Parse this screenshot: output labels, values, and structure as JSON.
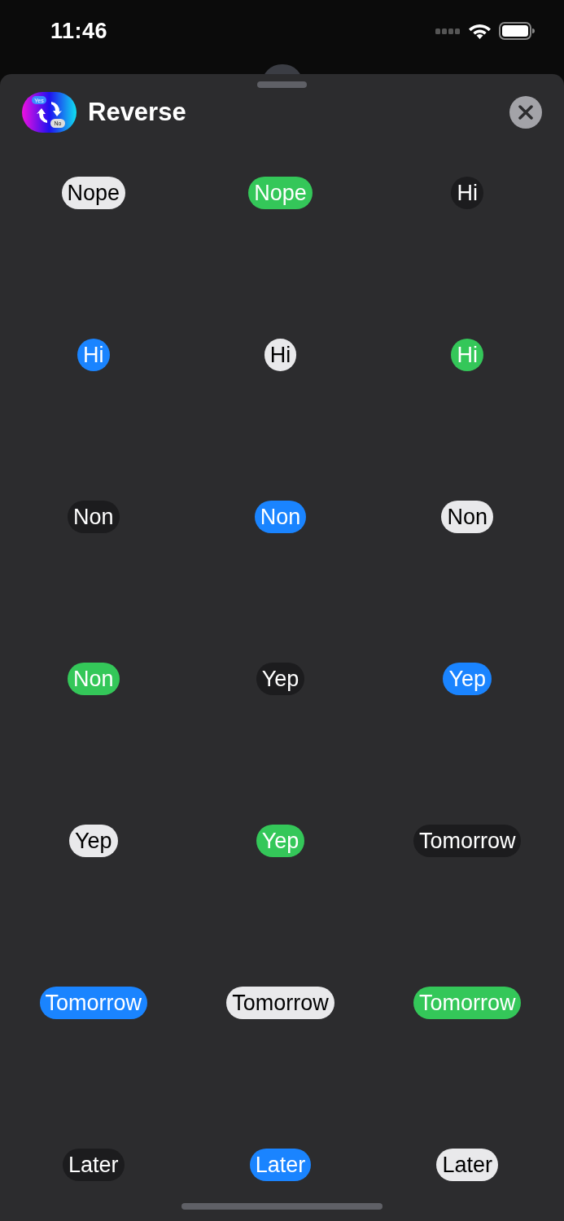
{
  "status_bar": {
    "time": "11:46"
  },
  "header": {
    "title": "Reverse",
    "logo": {
      "yes_label": "Yes",
      "no_label": "No"
    }
  },
  "stickers": [
    {
      "text": "Nope",
      "color": "#e9e9eb"
    },
    {
      "text": "Nope",
      "color": "#34c759"
    },
    {
      "text": "Hi",
      "color": "#1c1c1e"
    },
    {
      "text": "Hi",
      "color": "#1a84ff"
    },
    {
      "text": "Hi",
      "color": "#e9e9eb"
    },
    {
      "text": "Hi",
      "color": "#34c759"
    },
    {
      "text": "Non",
      "color": "#1c1c1e"
    },
    {
      "text": "Non",
      "color": "#1a84ff"
    },
    {
      "text": "Non",
      "color": "#e9e9eb"
    },
    {
      "text": "Non",
      "color": "#34c759"
    },
    {
      "text": "Yep",
      "color": "#1c1c1e"
    },
    {
      "text": "Yep",
      "color": "#1a84ff"
    },
    {
      "text": "Yep",
      "color": "#e9e9eb"
    },
    {
      "text": "Yep",
      "color": "#34c759"
    },
    {
      "text": "Tomorrow",
      "color": "#1c1c1e"
    },
    {
      "text": "Tomorrow",
      "color": "#1a84ff"
    },
    {
      "text": "Tomorrow",
      "color": "#e9e9eb"
    },
    {
      "text": "Tomorrow",
      "color": "#34c759"
    },
    {
      "text": "Later",
      "color": "#1c1c1e"
    },
    {
      "text": "Later",
      "color": "#1a84ff"
    },
    {
      "text": "Later",
      "color": "#e9e9eb"
    }
  ]
}
